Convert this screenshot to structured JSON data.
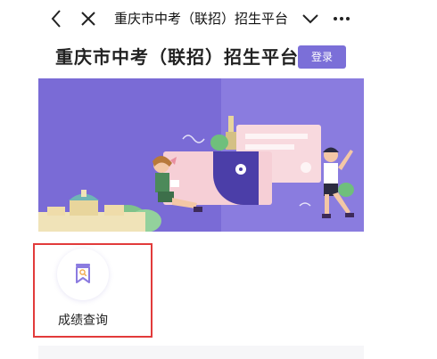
{
  "navbar": {
    "title": "重庆市中考（联招）招生平台",
    "back_icon": "back-arrow-icon",
    "close_icon": "close-icon",
    "menu_icon": "chevron-down-icon",
    "more_icon": "more-dots-icon"
  },
  "header": {
    "title": "重庆市中考（联招）招生平台",
    "login_label": "登录"
  },
  "banner": {
    "illustration": "students-with-certificate-banner"
  },
  "services": [
    {
      "label": "成绩查询",
      "icon": "score-search-icon"
    }
  ],
  "colors": {
    "accent": "#7b6fd8",
    "banner_bg": "#7a6bd6",
    "highlight_border": "#e23b3b"
  }
}
